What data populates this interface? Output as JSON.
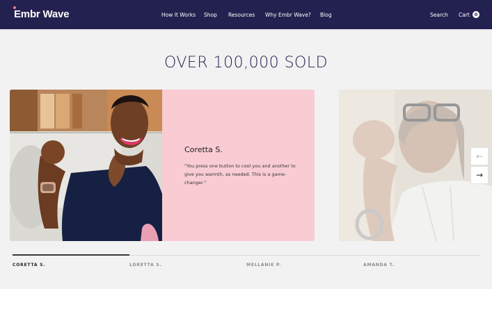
{
  "brand": {
    "logo_text": "Embr Wave"
  },
  "nav": {
    "links": [
      "How It Works",
      "Shop",
      "Resources",
      "Why Embr Wave?",
      "Blog"
    ],
    "search_label": "Search",
    "cart_label": "Cart",
    "cart_count": "0"
  },
  "section": {
    "title": "OVER 100,000 SOLD"
  },
  "testimonial": {
    "name": "Coretta S.",
    "quote": "\"You press one button to cool you and another to give you warmth, as needed. This is a game-changer.\""
  },
  "arrows": {
    "prev": "←",
    "next": "→"
  },
  "tabs": [
    {
      "label": "CORETTA S.",
      "active": true
    },
    {
      "label": "LORETTA S.",
      "active": false
    },
    {
      "label": "MELLANIE P.",
      "active": false
    },
    {
      "label": "AMANDA T.",
      "active": false
    }
  ],
  "colors": {
    "nav_bg": "#23214f",
    "card_pink": "#f9ccd3",
    "section_bg": "#f2f2f2",
    "title": "#23214f"
  },
  "icons": [
    "arrow-left-icon",
    "arrow-right-icon",
    "cart-icon"
  ]
}
